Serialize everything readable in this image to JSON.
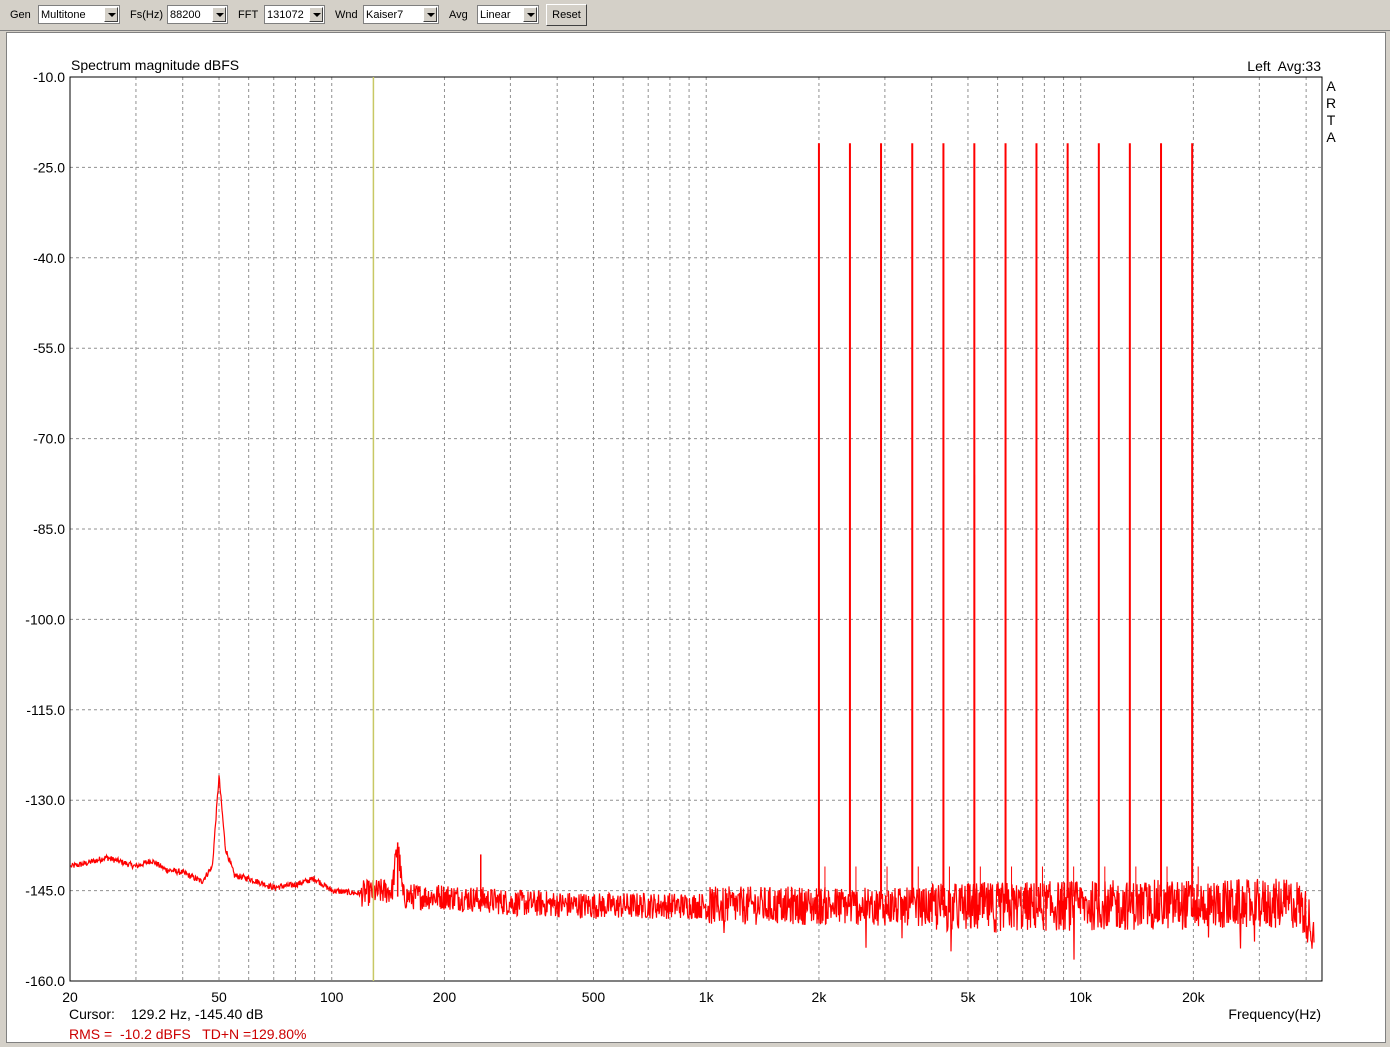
{
  "toolbar": {
    "gen": {
      "label": "Gen",
      "value": "Multitone"
    },
    "fs": {
      "label": "Fs(Hz)",
      "value": "88200"
    },
    "fft": {
      "label": "FFT",
      "value": "131072"
    },
    "wnd": {
      "label": "Wnd",
      "value": "Kaiser7"
    },
    "avg": {
      "label": "Avg",
      "value": "Linear"
    },
    "reset_label": "Reset"
  },
  "chart_data": {
    "type": "line",
    "title": "Spectrum magnitude dBFS",
    "channel_info": "Left  Avg:33",
    "brand_letters": [
      "A",
      "R",
      "T",
      "A"
    ],
    "xlabel": "Frequency(Hz)",
    "x_scale": "log",
    "xlim": [
      20,
      44100
    ],
    "ylim": [
      -160,
      -10
    ],
    "x_ticks": [
      20,
      50,
      100,
      200,
      500,
      1000,
      2000,
      5000,
      10000,
      20000
    ],
    "x_tick_labels": [
      "20",
      "50",
      "100",
      "200",
      "500",
      "1k",
      "2k",
      "5k",
      "10k",
      "20k"
    ],
    "y_ticks": [
      -10,
      -25,
      -40,
      -55,
      -70,
      -85,
      -100,
      -115,
      -130,
      -145,
      -160
    ],
    "y_tick_labels": [
      "-10.0",
      "-25.0",
      "-40.0",
      "-55.0",
      "-70.0",
      "-85.0",
      "-100.0",
      "-115.0",
      "-130.0",
      "-145.0",
      "-160.0"
    ],
    "grid": true,
    "colors": {
      "trace": "#ff0000",
      "cursor": "#c8c864",
      "grid": "#909090",
      "info": "#cc0000"
    },
    "cursor_frequency": 129.2,
    "tones": [
      {
        "freq": 2000,
        "level": -21
      },
      {
        "freq": 2420,
        "level": -21
      },
      {
        "freq": 2930,
        "level": -21
      },
      {
        "freq": 3550,
        "level": -21
      },
      {
        "freq": 4300,
        "level": -21
      },
      {
        "freq": 5200,
        "level": -21
      },
      {
        "freq": 6300,
        "level": -21
      },
      {
        "freq": 7620,
        "level": -21
      },
      {
        "freq": 9230,
        "level": -21
      },
      {
        "freq": 11180,
        "level": -21
      },
      {
        "freq": 13530,
        "level": -21
      },
      {
        "freq": 16390,
        "level": -21
      },
      {
        "freq": 19850,
        "level": -21
      }
    ],
    "noise_floor": [
      [
        20,
        -141
      ],
      [
        22,
        -140.5
      ],
      [
        25,
        -139.5
      ],
      [
        30,
        -141
      ],
      [
        33,
        -140
      ],
      [
        36,
        -141.5
      ],
      [
        40,
        -142
      ],
      [
        45,
        -143.5
      ],
      [
        48,
        -141
      ],
      [
        50,
        -126
      ],
      [
        52,
        -138
      ],
      [
        55,
        -142.5
      ],
      [
        60,
        -143
      ],
      [
        70,
        -144.5
      ],
      [
        80,
        -144
      ],
      [
        90,
        -143
      ],
      [
        100,
        -145
      ],
      [
        120,
        -145.5
      ],
      [
        145,
        -145
      ],
      [
        150,
        -137
      ],
      [
        155,
        -146
      ],
      [
        200,
        -146
      ],
      [
        250,
        -146.5
      ],
      [
        300,
        -147
      ],
      [
        500,
        -147.5
      ],
      [
        1000,
        -147.5
      ],
      [
        2000,
        -147.5
      ],
      [
        5000,
        -147.8
      ],
      [
        10000,
        -147.5
      ],
      [
        20000,
        -147.3
      ],
      [
        30000,
        -147.2
      ],
      [
        38000,
        -147.2
      ],
      [
        40000,
        -149
      ],
      [
        42000,
        -152
      ]
    ],
    "small_peaks": [
      {
        "freq": 150,
        "level": -137
      },
      {
        "freq": 250,
        "level": -139
      },
      {
        "freq": 2930,
        "level": -108
      },
      {
        "freq": 3550,
        "level": -76
      },
      {
        "freq": 5200,
        "level": -76
      },
      {
        "freq": 19850,
        "level": -108
      }
    ]
  },
  "cursor_readout": {
    "label": "Cursor:",
    "value": "129.2 Hz, -145.40 dB"
  },
  "rms_readout": "RMS =  -10.2 dBFS   TD+N =129.80%"
}
